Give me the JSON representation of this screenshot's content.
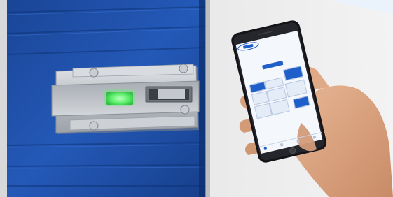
{
  "scene": {
    "description_free": true,
    "colors": {
      "door_blue": "#1f4fa8",
      "door_dark": "#123a86",
      "wall": "#e6e6e6",
      "plate_metal": "#c8cbd0",
      "led_green": "#5df06a",
      "phone_black": "#141418",
      "screen_bg": "#f4f7fc",
      "accent_blue": "#1e5fc9",
      "skin": "#d9a07e"
    }
  },
  "phone": {
    "status_text": "",
    "app_title": "",
    "app_subtitle": "",
    "unlock_label": "",
    "selected_unit_label": "",
    "icons": [
      "app-logo-icon",
      "home-tab-icon"
    ]
  }
}
